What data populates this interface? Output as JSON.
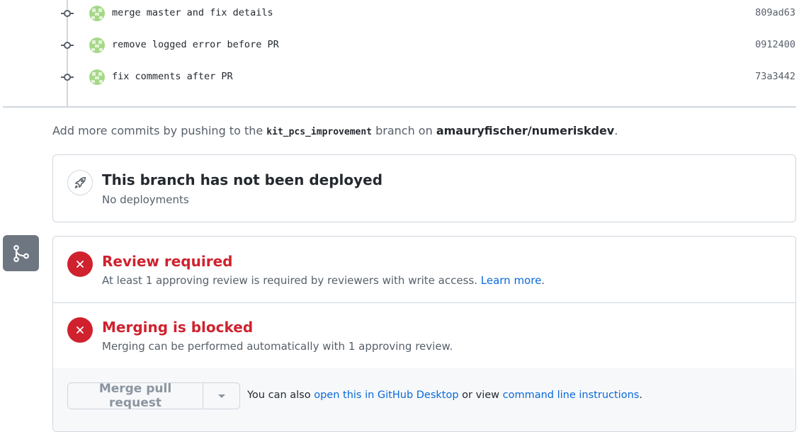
{
  "commits": [
    {
      "message": "merge master and fix details",
      "sha": "809ad63"
    },
    {
      "message": "remove logged error before PR",
      "sha": "0912400"
    },
    {
      "message": "fix comments after PR",
      "sha": "73a3442"
    }
  ],
  "push_note": {
    "prefix": "Add more commits by pushing to the ",
    "branch": "kit_pcs_improvement",
    "middle": " branch on ",
    "repo": "amauryfischer/numeriskdev",
    "suffix": "."
  },
  "deploy": {
    "title": "This branch has not been deployed",
    "subtitle": "No deployments",
    "icon": "rocket-icon"
  },
  "review": {
    "title": "Review required",
    "text": "At least 1 approving review is required by reviewers with write access. ",
    "link": "Learn more",
    "suffix": "."
  },
  "blocked": {
    "title": "Merging is blocked",
    "text": "Merging can be performed automatically with 1 approving review."
  },
  "footer": {
    "merge_button": "Merge pull request",
    "prefix": "You can also ",
    "desktop_link": "open this in GitHub Desktop",
    "middle": " or view ",
    "cli_link": "command line instructions",
    "suffix": "."
  },
  "colors": {
    "danger": "#cf222e",
    "link": "#0969da",
    "muted": "#57606a",
    "border": "#d0d7de"
  }
}
